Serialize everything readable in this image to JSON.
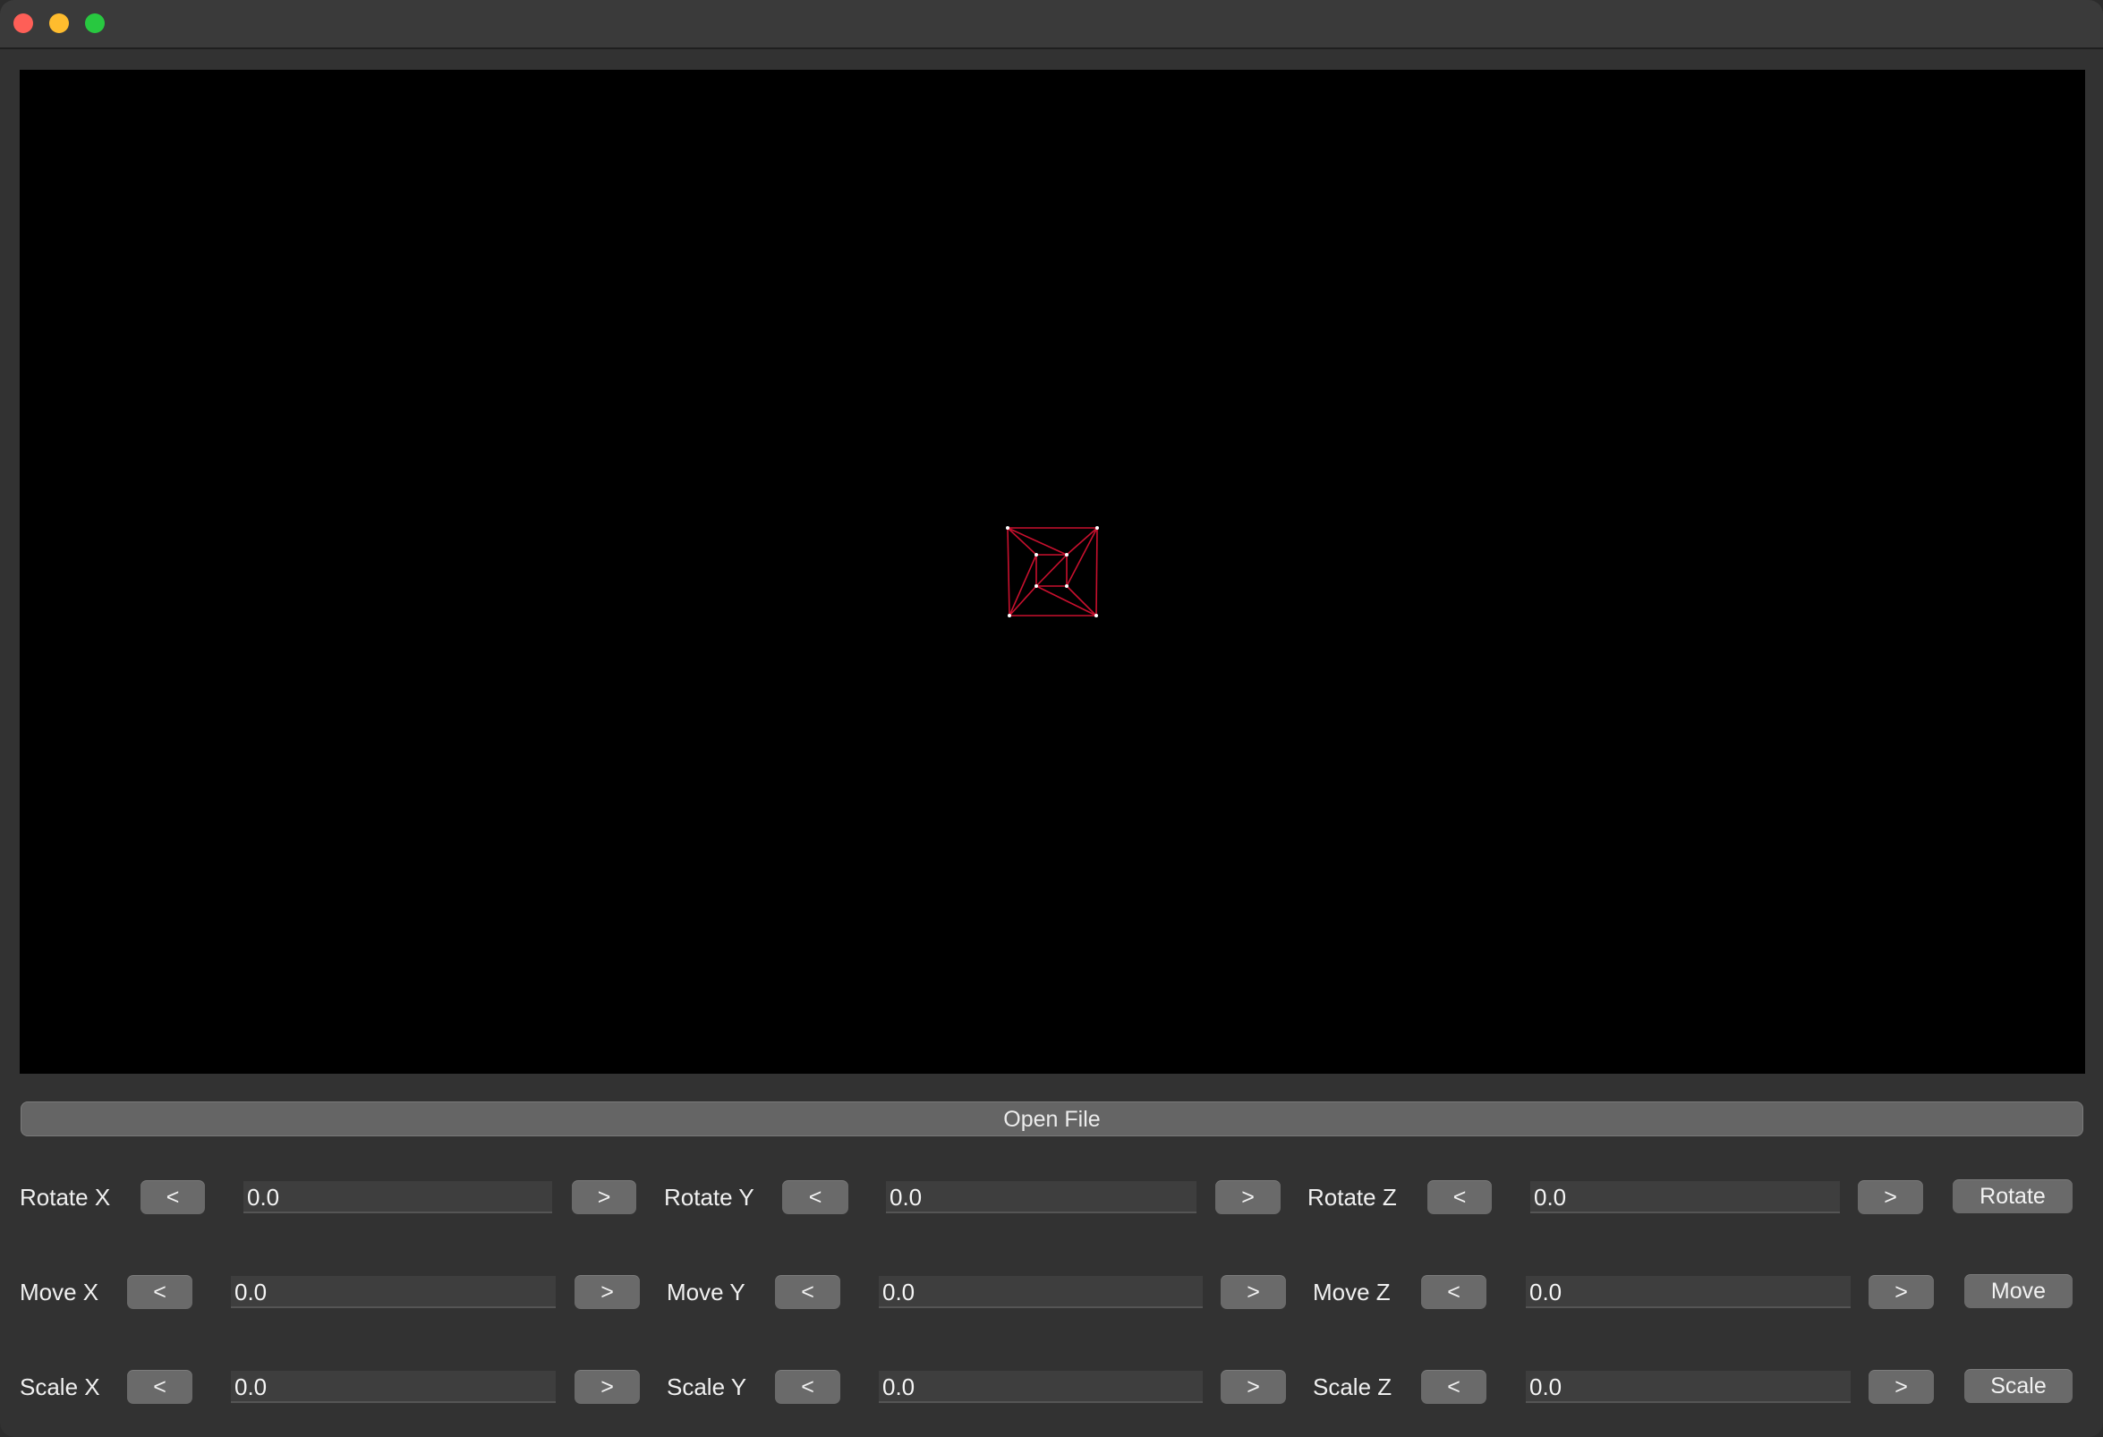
{
  "window": {
    "buttons": [
      "close",
      "minimize",
      "zoom"
    ]
  },
  "viewport": {
    "background": "#000000",
    "wireframe_color": "#c8102e",
    "vertex_color": "#ffffff"
  },
  "open_file_label": "Open File",
  "rotate": {
    "x_label": "Rotate X",
    "y_label": "Rotate Y",
    "z_label": "Rotate Z",
    "x_value": "0.0",
    "y_value": "0.0",
    "z_value": "0.0",
    "dec": "<",
    "inc": ">",
    "apply": "Rotate"
  },
  "move": {
    "x_label": "Move X",
    "y_label": "Move Y",
    "z_label": "Move Z",
    "x_value": "0.0",
    "y_value": "0.0",
    "z_value": "0.0",
    "dec": "<",
    "inc": ">",
    "apply": "Move"
  },
  "scale": {
    "x_label": "Scale X",
    "y_label": "Scale Y",
    "z_label": "Scale Z",
    "x_value": "0.0",
    "y_value": "0.0",
    "z_value": "0.0",
    "dec": "<",
    "inc": ">",
    "apply": "Scale"
  }
}
